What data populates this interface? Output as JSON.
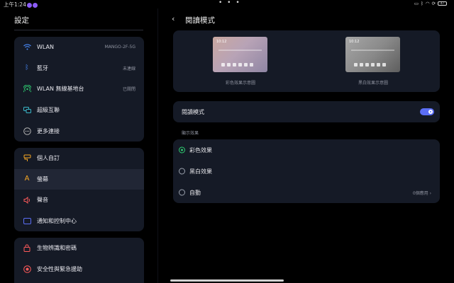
{
  "status": {
    "time": "上午1:24",
    "dots": "• • •",
    "battery": "47"
  },
  "left": {
    "title": "設定",
    "groups": [
      {
        "items": [
          {
            "label": "WLAN",
            "value": "MANGO-2F-5G",
            "icon": "wifi-icon",
            "color": "#4a8cff"
          },
          {
            "label": "藍牙",
            "value": "未連線",
            "icon": "bluetooth-icon",
            "color": "#4a8cff"
          },
          {
            "label": "WLAN 無線基地台",
            "value": "已關閉",
            "icon": "hotspot-icon",
            "color": "#2ecc71"
          },
          {
            "label": "超級互聯",
            "value": "",
            "icon": "link-icon",
            "color": "#3ab7c9"
          },
          {
            "label": "更多連接",
            "value": "",
            "icon": "more-icon",
            "color": "#b0b0b0"
          }
        ]
      },
      {
        "items": [
          {
            "label": "個人自訂",
            "value": "",
            "icon": "brush-icon",
            "color": "#f5a623"
          },
          {
            "label": "螢幕",
            "value": "",
            "icon": "display-icon",
            "color": "#f5a623",
            "active": true
          },
          {
            "label": "聲音",
            "value": "",
            "icon": "speaker-icon",
            "color": "#ff5a5a"
          },
          {
            "label": "通知和控制中心",
            "value": "",
            "icon": "notification-icon",
            "color": "#5b6ef5"
          }
        ]
      },
      {
        "items": [
          {
            "label": "生物辨識和密碼",
            "value": "",
            "icon": "lock-icon",
            "color": "#ff5a5a"
          },
          {
            "label": "安全性與緊急援助",
            "value": "",
            "icon": "sos-icon",
            "color": "#ff5a5a"
          }
        ]
      }
    ]
  },
  "right": {
    "title": "閱讀模式",
    "previews": [
      {
        "label": "彩色效果示意圖",
        "time": "10:12"
      },
      {
        "label": "黑白效果示意圖",
        "time": "10:12"
      }
    ],
    "toggle_label": "閱讀模式",
    "toggle_on": true,
    "section_label": "顯示效果",
    "options": [
      {
        "label": "彩色效果",
        "selected": true,
        "meta": ""
      },
      {
        "label": "黑白效果",
        "selected": false,
        "meta": ""
      },
      {
        "label": "自動",
        "selected": false,
        "meta": "0個應用 ›"
      }
    ]
  },
  "colors": {
    "accent": "#5b6ef5",
    "selected": "#2ecc71",
    "card": "#151a26",
    "background": "#000000"
  }
}
